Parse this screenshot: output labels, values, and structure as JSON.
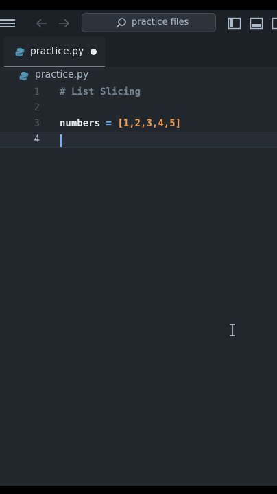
{
  "titlebar": {
    "search_placeholder": "practice files"
  },
  "tabs": [
    {
      "label": "practice.py",
      "dirty": true
    }
  ],
  "breadcrumb": {
    "file": "practice.py"
  },
  "editor": {
    "lines": [
      {
        "number": "1",
        "comment": "# List Slicing"
      },
      {
        "number": "2"
      },
      {
        "number": "3",
        "ident": "numbers",
        "op": "=",
        "open": "[",
        "nums": "1,2,3,4,5",
        "close": "]"
      },
      {
        "number": "4",
        "active": true
      }
    ]
  },
  "colors": {
    "background": "#22272e",
    "comment": "#768390",
    "keyword_blue": "#6cb6ff",
    "number_orange": "#f69d50",
    "python_icon": "#519aba"
  }
}
